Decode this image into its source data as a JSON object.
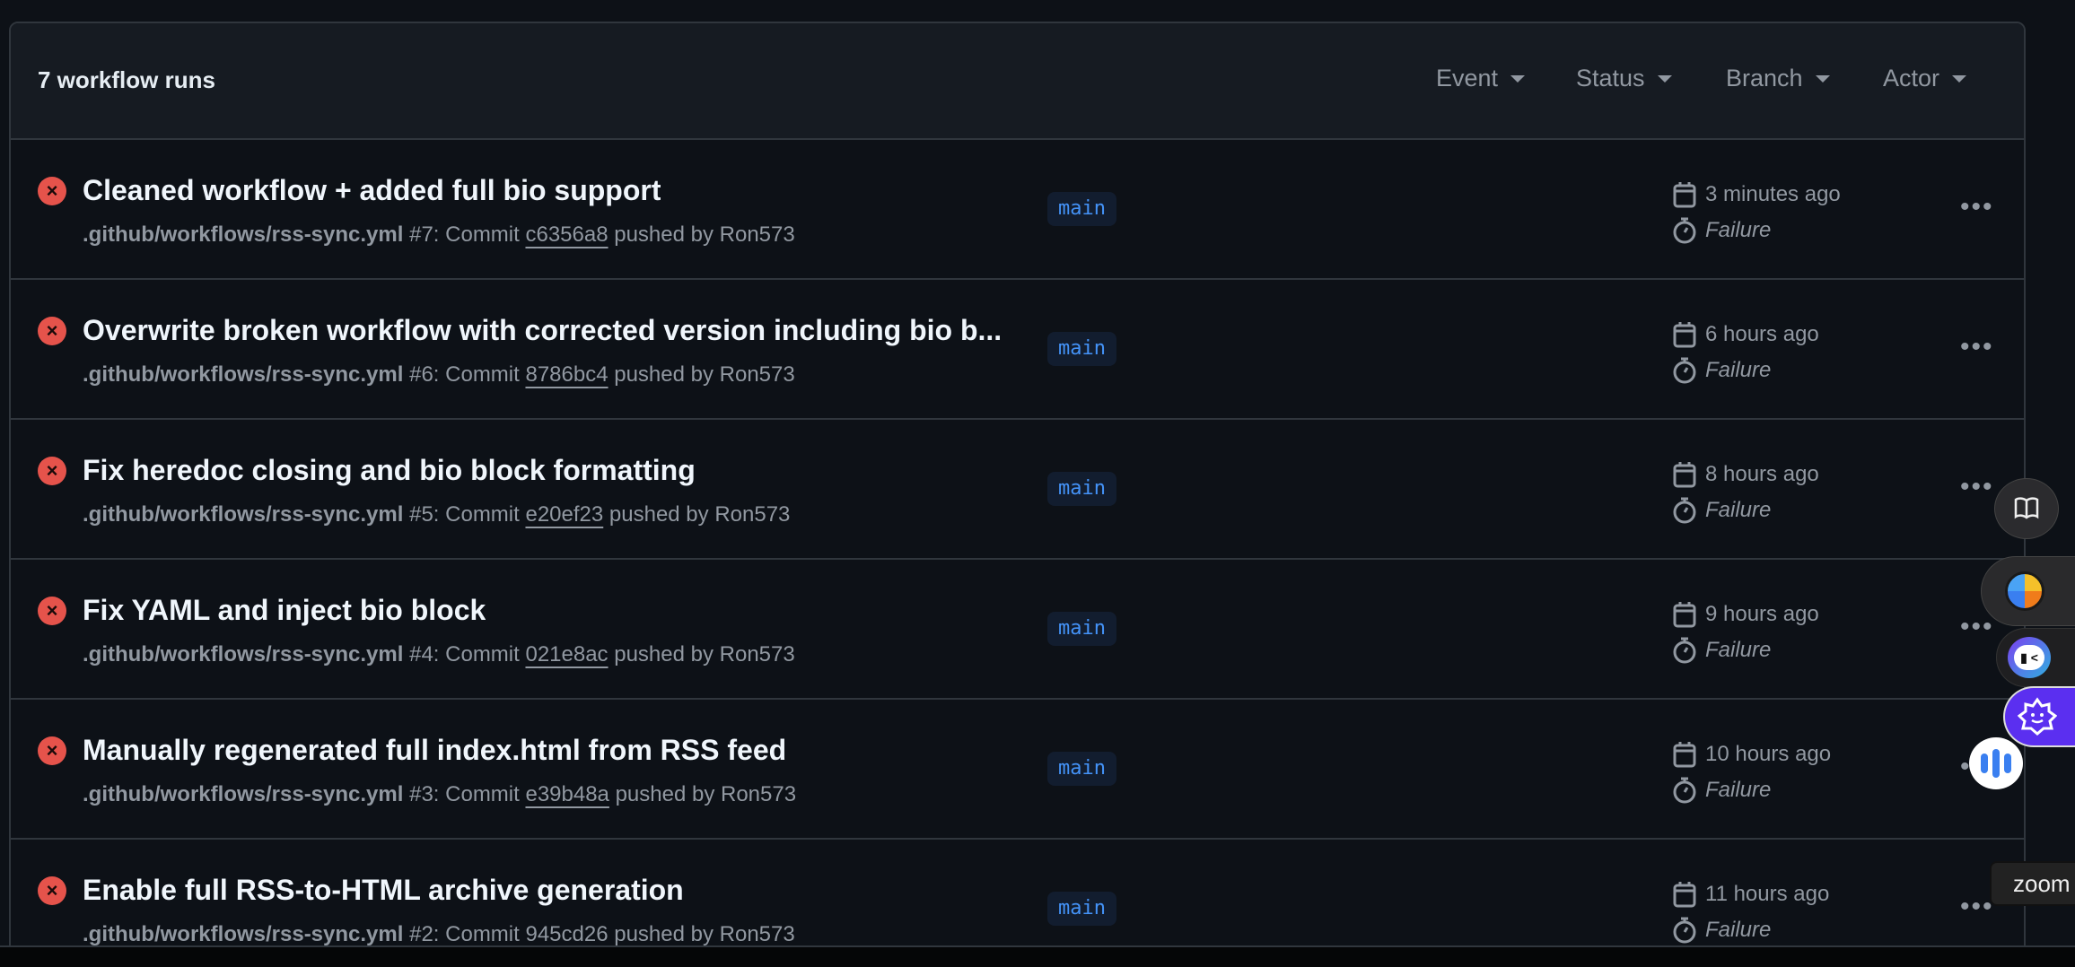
{
  "header": {
    "count_label": "7 workflow runs",
    "filters": [
      "Event",
      "Status",
      "Branch",
      "Actor"
    ]
  },
  "runs": [
    {
      "title": "Cleaned workflow + added full bio support",
      "workflow": ".github/workflows/rss-sync.yml",
      "number": "#7",
      "commit_prefix": ": Commit ",
      "commit": "c6356a8",
      "pushed_by": " pushed by Ron573",
      "branch": "main",
      "time": "3 minutes ago",
      "status": "Failure"
    },
    {
      "title": "Overwrite broken workflow with corrected version including bio b...",
      "workflow": ".github/workflows/rss-sync.yml",
      "number": "#6",
      "commit_prefix": ": Commit ",
      "commit": "8786bc4",
      "pushed_by": " pushed by Ron573",
      "branch": "main",
      "time": "6 hours ago",
      "status": "Failure"
    },
    {
      "title": "Fix heredoc closing and bio block formatting",
      "workflow": ".github/workflows/rss-sync.yml",
      "number": "#5",
      "commit_prefix": ": Commit ",
      "commit": "e20ef23",
      "pushed_by": " pushed by Ron573",
      "branch": "main",
      "time": "8 hours ago",
      "status": "Failure"
    },
    {
      "title": "Fix YAML and inject bio block",
      "workflow": ".github/workflows/rss-sync.yml",
      "number": "#4",
      "commit_prefix": ": Commit ",
      "commit": "021e8ac",
      "pushed_by": " pushed by Ron573",
      "branch": "main",
      "time": "9 hours ago",
      "status": "Failure"
    },
    {
      "title": "Manually regenerated full index.html from RSS feed",
      "workflow": ".github/workflows/rss-sync.yml",
      "number": "#3",
      "commit_prefix": ": Commit ",
      "commit": "e39b48a",
      "pushed_by": " pushed by Ron573",
      "branch": "main",
      "time": "10 hours ago",
      "status": "Failure"
    },
    {
      "title": "Enable full RSS-to-HTML archive generation",
      "workflow": ".github/workflows/rss-sync.yml",
      "number": "#2",
      "commit_prefix": ": Commit ",
      "commit": "945cd26",
      "pushed_by": " pushed by Ron573",
      "branch": "main",
      "time": "11 hours ago",
      "status": "Failure"
    }
  ],
  "tooltip": "zoom",
  "colors": {
    "failure": "#e5534b",
    "branch": "#4493f8",
    "accent_purple": "#5b2ff0"
  }
}
